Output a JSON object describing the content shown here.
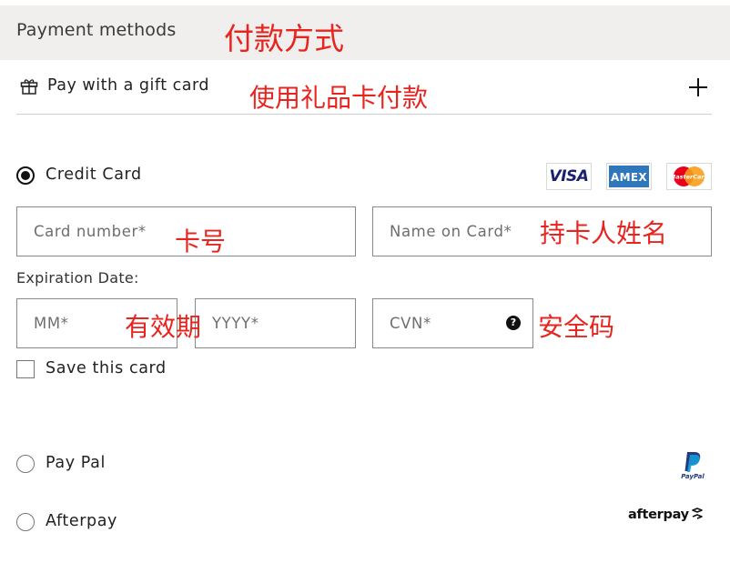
{
  "header": {
    "title": "Payment methods"
  },
  "annotations": {
    "payment_methods": "付款方式",
    "gift_card": "使用礼品卡付款",
    "card_number": "卡号",
    "name_on_card": "持卡人姓名",
    "expiration": "有效期",
    "cvn": "安全码"
  },
  "gift_card": {
    "label": "Pay with a gift card",
    "icon": "gift-icon",
    "expand_icon": "plus-icon"
  },
  "credit_card": {
    "label": "Credit Card",
    "selected": true,
    "logos": [
      "VISA",
      "AMEX",
      "MasterCard"
    ],
    "card_number_placeholder": "Card number*",
    "name_placeholder": "Name on Card*",
    "expiration_label": "Expiration Date:",
    "month_placeholder": "MM*",
    "year_placeholder": "YYYY*",
    "cvn_placeholder": "CVN*",
    "cvn_help_icon": "?",
    "save_label": "Save this card",
    "save_checked": false
  },
  "paypal": {
    "label": "Pay Pal",
    "logo_text": "PayPal",
    "selected": false
  },
  "afterpay": {
    "label": "Afterpay",
    "logo_text": "afterpay",
    "selected": false
  },
  "colors": {
    "header_bg": "#f0efee",
    "annotation": "#e8241f",
    "visa": "#1a1f71",
    "amex": "#2e77bb",
    "mastercard_red": "#eb001b",
    "mastercard_orange": "#f79e1b",
    "paypal_dark": "#253b80",
    "paypal_light": "#179bd7"
  }
}
